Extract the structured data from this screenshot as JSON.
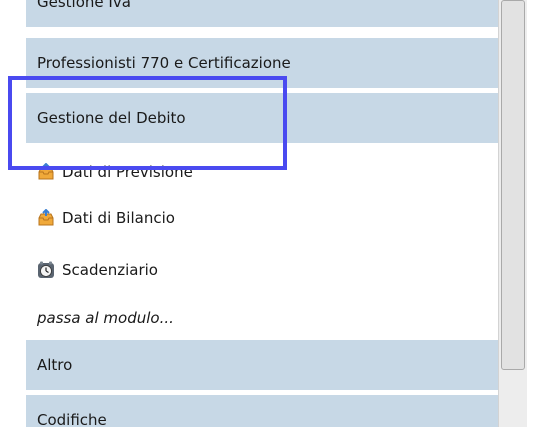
{
  "menu": {
    "sections": [
      {
        "label": "Gestione Iva"
      },
      {
        "label": "Professionisti 770 e Certificazione"
      },
      {
        "label": "Gestione del Debito"
      },
      {
        "label": "Altro"
      },
      {
        "label": "Codifiche"
      }
    ],
    "links": [
      {
        "label": "Dati di Previsione",
        "icon": "inbox-icon"
      },
      {
        "label": "Dati di Bilancio",
        "icon": "inbox-icon"
      },
      {
        "label": "Scadenziario",
        "icon": "clock-icon"
      }
    ],
    "more_link": "passa al modulo..."
  },
  "colors": {
    "section_bg": "#c7d8e6",
    "highlight_border": "#4a4af0"
  }
}
